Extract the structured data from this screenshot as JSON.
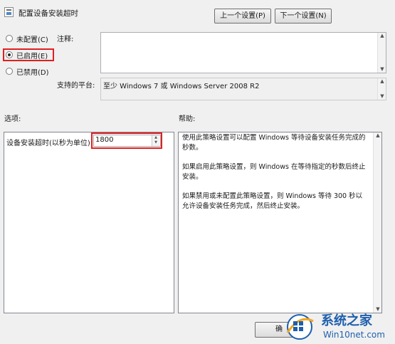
{
  "window": {
    "title": "配置设备安装超时"
  },
  "nav": {
    "prev_label": "上一个设置(P)",
    "next_label": "下一个设置(N)"
  },
  "state": {
    "options": [
      {
        "label": "未配置(C)",
        "checked": false
      },
      {
        "label": "已启用(E)",
        "checked": true
      },
      {
        "label": "已禁用(D)",
        "checked": false
      }
    ]
  },
  "comment": {
    "label": "注释:",
    "value": ""
  },
  "platform": {
    "label": "支持的平台:",
    "value": "至少 Windows 7 或 Windows Server 2008 R2"
  },
  "options_section": {
    "heading": "选项:",
    "timeout_label": "设备安装超时(以秒为单位)",
    "timeout_value": "1800"
  },
  "help_section": {
    "heading": "帮助:",
    "paragraphs": [
      "使用此策略设置可以配置 Windows 等待设备安装任务完成的秒数。",
      "如果启用此策略设置，则 Windows 在等待指定的秒数后终止安装。",
      "如果禁用或未配置此策略设置，则 Windows 等待 300 秒以允许设备安装任务完成，然后终止安装。"
    ]
  },
  "footer": {
    "ok_label": "确"
  },
  "watermark": {
    "title": "系统之家",
    "url": "Win10net.com"
  }
}
